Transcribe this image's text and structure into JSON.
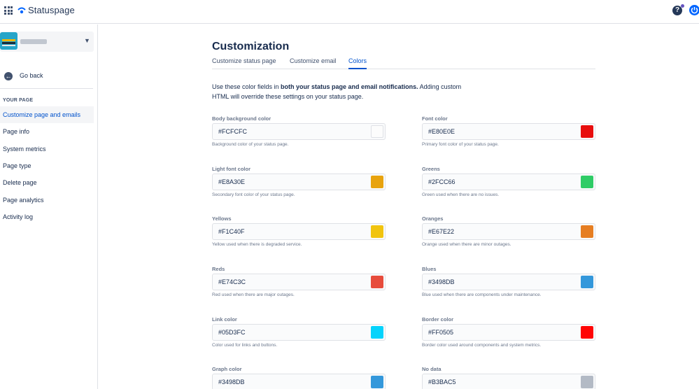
{
  "app": {
    "name": "Statuspage",
    "help_glyph": "?"
  },
  "sidebar": {
    "back_label": "Go back",
    "section_heading": "YOUR PAGE",
    "items": [
      {
        "label": "Customize page and emails",
        "active": true
      },
      {
        "label": "Page info",
        "active": false
      },
      {
        "label": "System metrics",
        "active": false
      },
      {
        "label": "Page type",
        "active": false
      },
      {
        "label": "Delete page",
        "active": false
      },
      {
        "label": "Page analytics",
        "active": false
      },
      {
        "label": "Activity log",
        "active": false
      }
    ]
  },
  "main": {
    "title": "Customization",
    "tabs": [
      {
        "label": "Customize status page",
        "active": false
      },
      {
        "label": "Customize email",
        "active": false
      },
      {
        "label": "Colors",
        "active": true
      }
    ],
    "intro": {
      "part1": "Use these color fields in ",
      "bold": "both your status page and email notifications.",
      "part2": " Adding custom HTML will override these settings on your status page."
    },
    "fields": [
      {
        "label": "Body background color",
        "value": "#FCFCFC",
        "help": "Background color of your status page.",
        "swatch": "#FCFCFC"
      },
      {
        "label": "Font color",
        "value": "#E80E0E",
        "help": "Primary font color of your status page.",
        "swatch": "#E80E0E"
      },
      {
        "label": "Light font color",
        "value": "#E8A30E",
        "help": "Secondary font color of your status page.",
        "swatch": "#E8A30E"
      },
      {
        "label": "Greens",
        "value": "#2FCC66",
        "help": "Green used when there are no issues.",
        "swatch": "#2FCC66"
      },
      {
        "label": "Yellows",
        "value": "#F1C40F",
        "help": "Yellow used when there is degraded service.",
        "swatch": "#F1C40F"
      },
      {
        "label": "Oranges",
        "value": "#E67E22",
        "help": "Orange used when there are minor outages.",
        "swatch": "#E67E22"
      },
      {
        "label": "Reds",
        "value": "#E74C3C",
        "help": "Red used when there are major outages.",
        "swatch": "#E74C3C"
      },
      {
        "label": "Blues",
        "value": "#3498DB",
        "help": "Blue used when there are components under maintenance.",
        "swatch": "#3498DB"
      },
      {
        "label": "Link color",
        "value": "#05D3FC",
        "help": "Color used for links and buttons.",
        "swatch": "#05D3FC"
      },
      {
        "label": "Border color",
        "value": "#FF0505",
        "help": "Border color used around components and system metrics.",
        "swatch": "#FF0505"
      },
      {
        "label": "Graph color",
        "value": "#3498DB",
        "help": "",
        "swatch": "#3498DB"
      },
      {
        "label": "No data",
        "value": "#B3BAC5",
        "help": "",
        "swatch": "#B3BAC5"
      }
    ]
  },
  "colors": {
    "accent": "#0052CC",
    "brand_icon": "#0065FF"
  }
}
